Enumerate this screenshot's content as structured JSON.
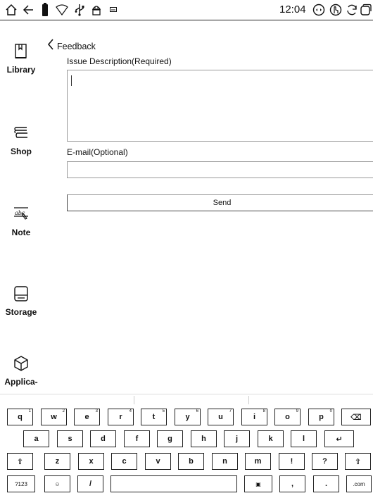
{
  "status_bar": {
    "time": "12:04",
    "icons": [
      "home-icon",
      "back-arrow-icon",
      "battery-icon",
      "wifi-icon",
      "usb-icon",
      "android-debug-icon",
      "keyboard-icon",
      "refresh-screen-icon",
      "touch-icon",
      "sync-icon",
      "recent-apps-icon"
    ]
  },
  "sidebar": {
    "items": [
      {
        "label": "Library",
        "icon": "library-book-icon"
      },
      {
        "label": "Shop",
        "icon": "shop-books-icon"
      },
      {
        "label": "Note",
        "icon": "note-pen-icon"
      },
      {
        "label": "Storage",
        "icon": "storage-icon"
      },
      {
        "label": "Applica-",
        "icon": "applications-cube-icon"
      }
    ]
  },
  "main": {
    "title": "Feedback",
    "issue_label": "Issue Description(Required)",
    "issue_value": "",
    "email_label": "E-mail(Optional)",
    "email_value": "",
    "send_label": "Send"
  },
  "keyboard": {
    "row1": [
      {
        "key": "q",
        "hint": "1"
      },
      {
        "key": "w",
        "hint": "2"
      },
      {
        "key": "e",
        "hint": "3"
      },
      {
        "key": "r",
        "hint": "4"
      },
      {
        "key": "t",
        "hint": "5"
      },
      {
        "key": "y",
        "hint": "6"
      },
      {
        "key": "u",
        "hint": "7"
      },
      {
        "key": "i",
        "hint": "8"
      },
      {
        "key": "o",
        "hint": "9"
      },
      {
        "key": "p",
        "hint": "0"
      }
    ],
    "row2": [
      "a",
      "s",
      "d",
      "f",
      "g",
      "h",
      "j",
      "k",
      "l"
    ],
    "row3": [
      "z",
      "x",
      "c",
      "v",
      "b",
      "n",
      "m",
      "!",
      "?"
    ],
    "row4": {
      "symbols": "?123",
      "emoji": "☺",
      "slash": "/",
      "comma": ",",
      "period": ".",
      "dotcom": ".com"
    },
    "enter_glyph": "↵",
    "backspace_glyph": "⌫",
    "shift_glyph": "⇧"
  }
}
